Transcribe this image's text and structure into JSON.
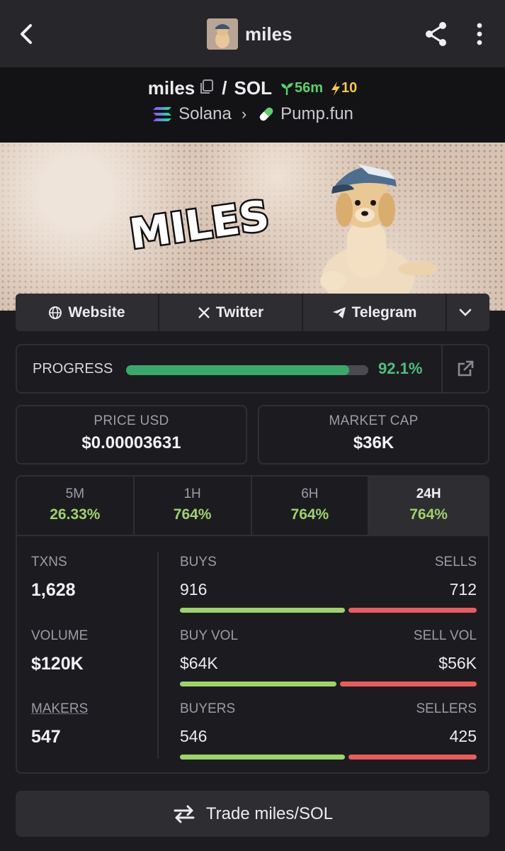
{
  "app": {
    "title": "miles"
  },
  "pair": {
    "base": "miles",
    "quote": "SOL",
    "separator": "/",
    "age": "56m",
    "boosts": "10",
    "chain": "Solana",
    "dex": "Pump.fun"
  },
  "socials": {
    "website_label": "Website",
    "twitter_label": "Twitter",
    "telegram_label": "Telegram"
  },
  "progress": {
    "label": "PROGRESS",
    "value_text": "92.1%",
    "fraction": 0.921
  },
  "stats": {
    "price_label": "PRICE USD",
    "price_value": "$0.00003631",
    "mcap_label": "MARKET CAP",
    "mcap_value": "$36K"
  },
  "timeframes": [
    {
      "label": "5M",
      "value": "26.33%"
    },
    {
      "label": "1H",
      "value": "764%"
    },
    {
      "label": "6H",
      "value": "764%"
    },
    {
      "label": "24H",
      "value": "764%",
      "active": true
    }
  ],
  "txns": {
    "txns_label": "TXNS",
    "txns_value": "1,628",
    "volume_label": "VOLUME",
    "volume_value": "$120K",
    "makers_label": "MAKERS",
    "makers_value": "547",
    "buys_label": "BUYS",
    "buys_value": "916",
    "sells_label": "SELLS",
    "sells_value": "712",
    "buy_vol_label": "BUY VOL",
    "buy_vol_value": "$64K",
    "sell_vol_label": "SELL VOL",
    "sell_vol_value": "$56K",
    "buyers_label": "BUYERS",
    "buyers_value": "546",
    "sellers_label": "SELLERS",
    "sellers_value": "425",
    "buy_ratio": 0.5627,
    "buy_vol_ratio": 0.5333,
    "buyer_ratio": 0.5623
  },
  "trade": {
    "label": "Trade miles/SOL"
  },
  "banner": {
    "logo_text": "MILES"
  },
  "colors": {
    "accent_green": "#9ed36a",
    "progress_green": "#3aa86a",
    "sell_red": "#ea5c5c",
    "age_green": "#5ccf6c",
    "boost_yellow": "#f5c842"
  }
}
